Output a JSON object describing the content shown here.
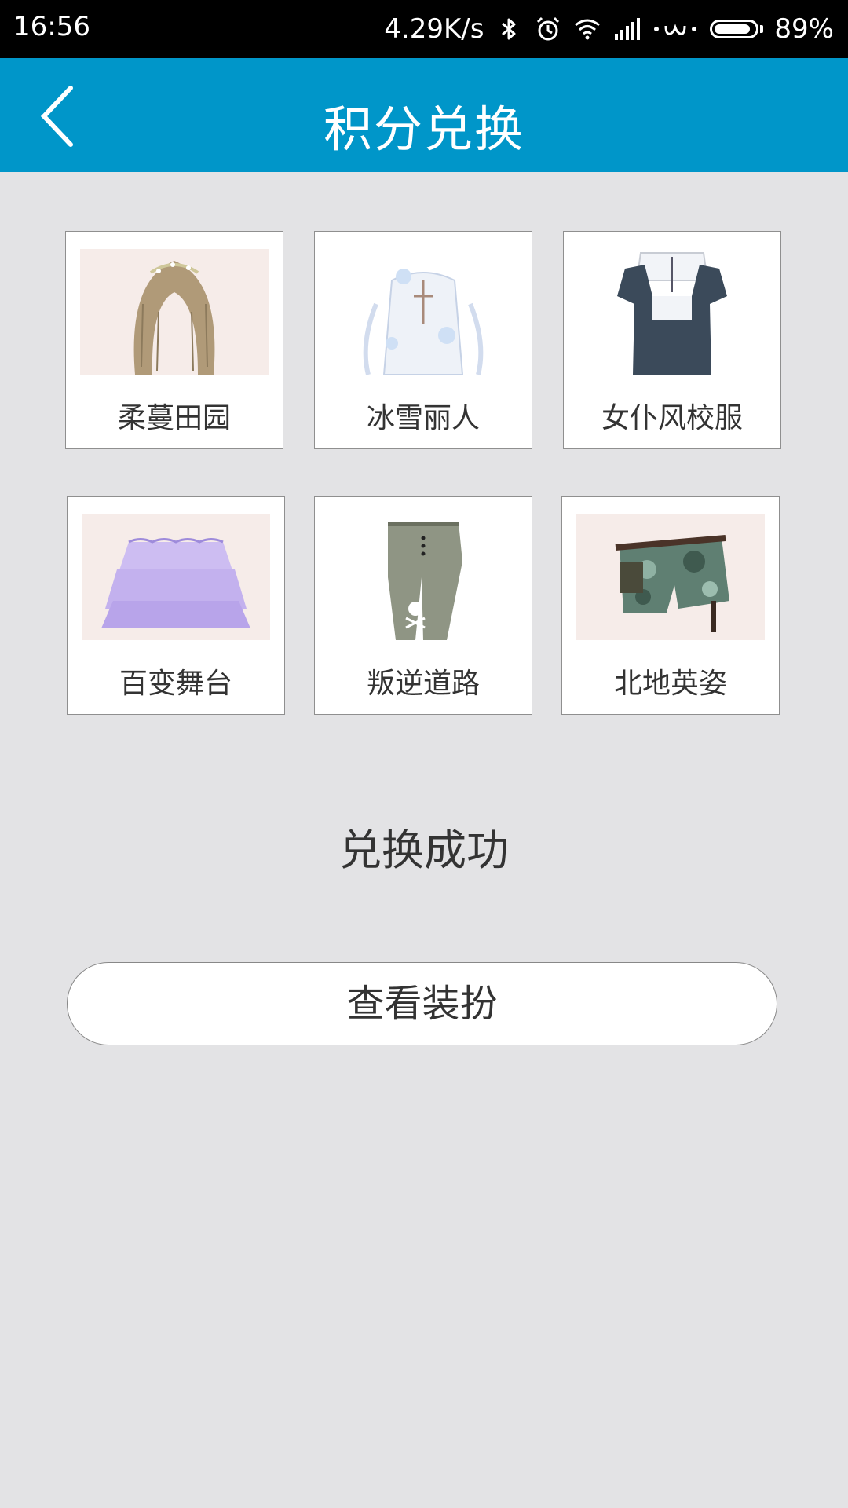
{
  "status_bar": {
    "time": "16:56",
    "net_speed": "4.29K/s",
    "battery_level": 0.89,
    "battery_text": "89%",
    "icons": [
      "bluetooth-icon",
      "alarm-icon",
      "wifi-icon",
      "signal-icon",
      "notification-dots-icon",
      "battery-icon"
    ]
  },
  "header": {
    "title": "积分兑换",
    "back_icon": "chevron-left-icon",
    "color": "#0096c9"
  },
  "items": [
    {
      "name": "柔蔓田园",
      "icon": "hairstyle-image"
    },
    {
      "name": "冰雪丽人",
      "icon": "dress-image"
    },
    {
      "name": "女仆风校服",
      "icon": "uniform-top-image"
    },
    {
      "name": "百变舞台",
      "icon": "skirt-image"
    },
    {
      "name": "叛逆道路",
      "icon": "pants-image"
    },
    {
      "name": "北地英姿",
      "icon": "shorts-image"
    }
  ],
  "result_text": "兑换成功",
  "action_button": "查看装扮"
}
